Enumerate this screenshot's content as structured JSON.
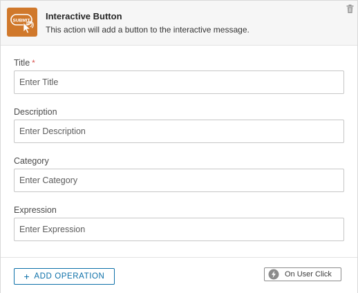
{
  "header": {
    "icon": "submit-button-icon",
    "icon_text": "SUBMIT",
    "title": "Interactive Button",
    "subtitle": "This action will add a button to the interactive message.",
    "delete_icon": "trash-icon"
  },
  "fields": [
    {
      "label": "Title",
      "required": true,
      "required_mark": "*",
      "value": "",
      "placeholder": "Enter Title"
    },
    {
      "label": "Description",
      "required": false,
      "value": "",
      "placeholder": "Enter Description"
    },
    {
      "label": "Category",
      "required": false,
      "value": "",
      "placeholder": "Enter Category"
    },
    {
      "label": "Expression",
      "required": false,
      "value": "",
      "placeholder": "Enter Expression"
    }
  ],
  "footer": {
    "add_operation_icon": "plus-icon",
    "add_operation_symbol": "+",
    "add_operation_label": "ADD OPERATION",
    "trigger_icon": "lightning-bolt-icon",
    "trigger_label": "On User Click"
  },
  "colors": {
    "icon_background": "#d0782b",
    "primary_blue": "#0b6fa8",
    "required_red": "#d9534f",
    "header_background": "#f6f6f6"
  }
}
